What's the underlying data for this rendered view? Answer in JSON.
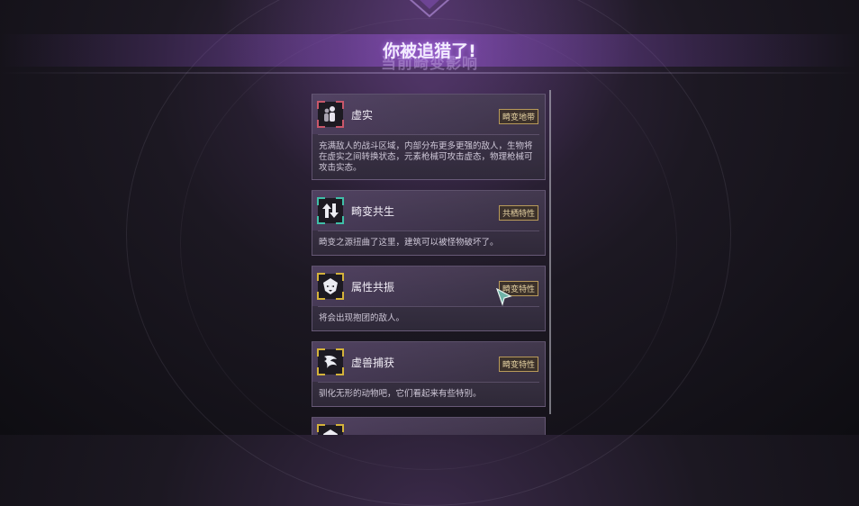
{
  "header": {
    "title": "你被追猎了!",
    "subtitle": "当前畸变影响"
  },
  "cards": [
    {
      "title": "虚实",
      "tag": "畸变地带",
      "description": "充满敌人的战斗区域，内部分布更多更强的敌人，生物将在虚实之间转换状态，元素枪械可攻击虚态，物理枪械可攻击实态。",
      "icon": "humanoid-figures-icon",
      "accent": "#c8576a"
    },
    {
      "title": "畸变共生",
      "tag": "共栖特性",
      "description": "畸变之源扭曲了这里，建筑可以被怪物破坏了。",
      "icon": "broken-arrows-icon",
      "accent": "#3fbfa8"
    },
    {
      "title": "属性共振",
      "tag": "畸变特性",
      "description": "将会出现抱团的敌人。",
      "icon": "demon-mask-icon",
      "accent": "#d4b23a"
    },
    {
      "title": "虚兽捕获",
      "tag": "畸变特性",
      "description": "驯化无形的动物吧，它们看起来有些特别。",
      "icon": "beast-claw-icon",
      "accent": "#d4b23a"
    },
    {
      "title": "",
      "tag": "",
      "description": "",
      "icon": "demon-mask-icon",
      "accent": "#d4b23a"
    }
  ]
}
